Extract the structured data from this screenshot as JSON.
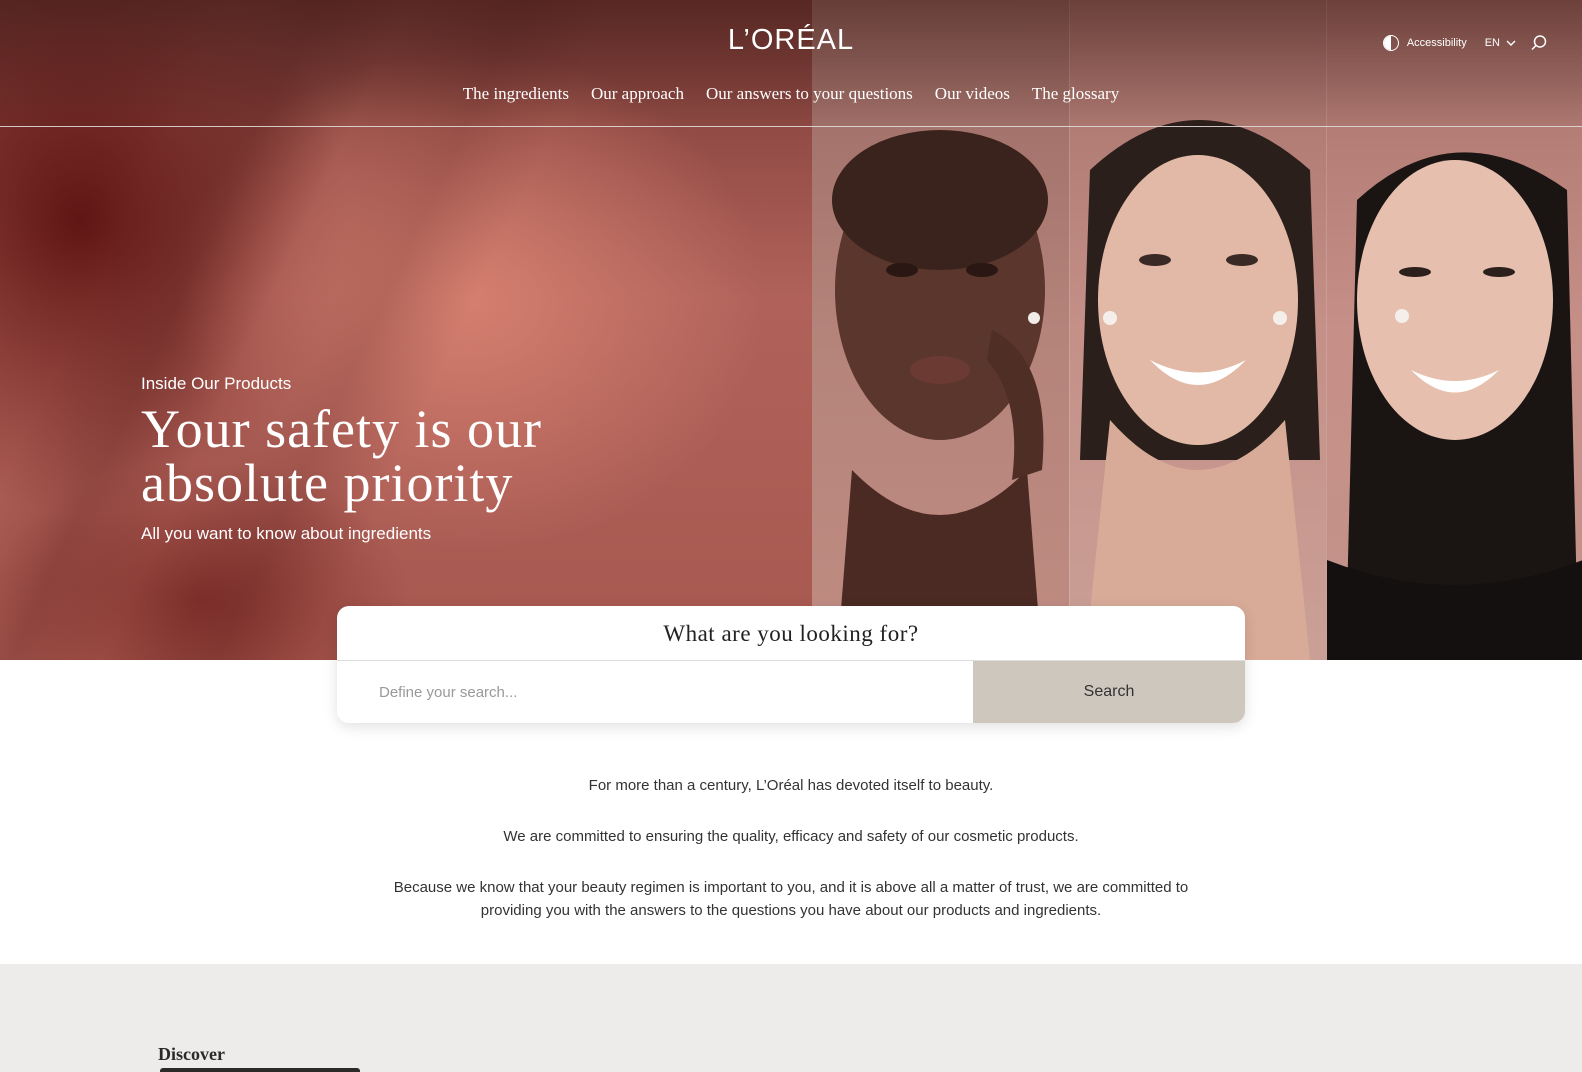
{
  "header": {
    "logo": "L’ORÉAL",
    "accessibility_label": "Accessibility",
    "language": "EN",
    "nav": [
      "The ingredients",
      "Our approach",
      "Our answers to your questions",
      "Our videos",
      "The glossary"
    ]
  },
  "hero": {
    "eyebrow": "Inside Our Products",
    "headline_line1": "Your safety is our",
    "headline_line2": "absolute priority",
    "subline": "All you want to know about ingredients"
  },
  "search": {
    "title": "What are you looking for?",
    "placeholder": "Define your search...",
    "button_label": "Search"
  },
  "intro": {
    "p1": "For more than a century, L’Oréal has devoted itself to beauty.",
    "p2": "We are committed to ensuring the quality, efficacy and safety of our cosmetic products.",
    "p3": "Because we know that your beauty regimen is important to you, and it is above all a matter of trust, we are committed to providing you with the answers to the questions you have about our products and ingredients."
  },
  "discover": {
    "label": "Discover"
  },
  "colors": {
    "hero_base": "#a7584f",
    "search_button": "#cdc7bd",
    "discover_bg": "#edecea"
  },
  "icons": [
    "contrast-icon",
    "chevron-down-icon",
    "search-icon"
  ]
}
